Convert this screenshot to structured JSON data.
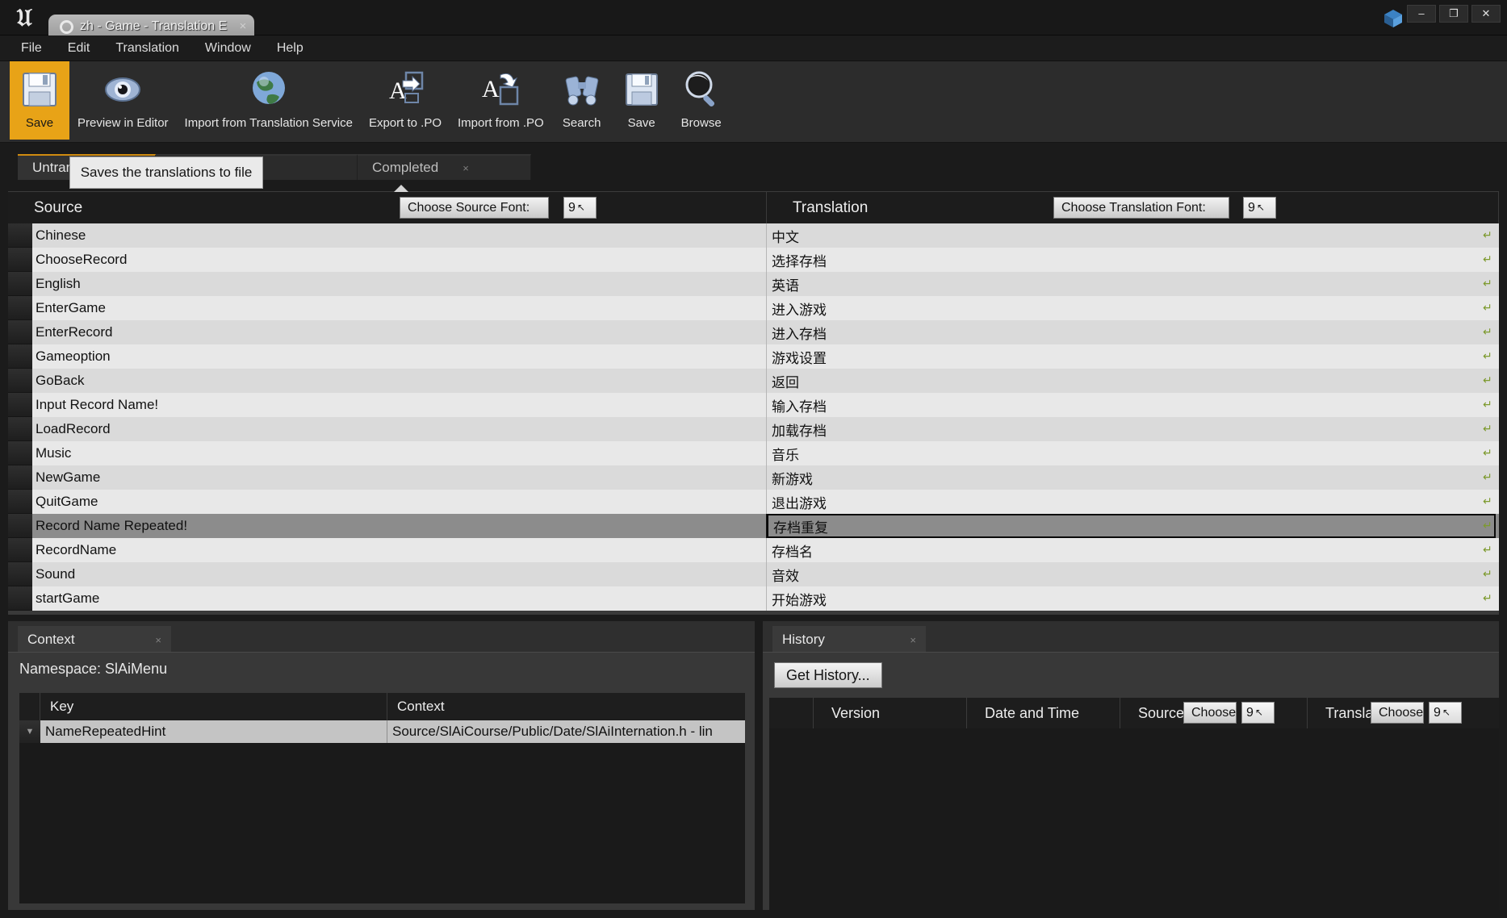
{
  "window": {
    "tab_title": "zh - Game - Translation E",
    "tab_close": "×",
    "minimize": "–",
    "maximize": "❐",
    "close": "✕"
  },
  "menubar": {
    "items": [
      {
        "label": "File"
      },
      {
        "label": "Edit"
      },
      {
        "label": "Translation"
      },
      {
        "label": "Window"
      },
      {
        "label": "Help"
      }
    ]
  },
  "toolbar": {
    "items": [
      {
        "label": "Save",
        "icon": "floppy-disk-icon",
        "active": true
      },
      {
        "label": "Preview in Editor",
        "icon": "eye-icon",
        "active": false
      },
      {
        "label": "Import from Translation Service",
        "icon": "globe-icon",
        "active": false
      },
      {
        "label": "Export to .PO",
        "icon": "export-letter-icon",
        "active": false
      },
      {
        "label": "Import from .PO",
        "icon": "import-letter-icon",
        "active": false
      },
      {
        "label": "Search",
        "icon": "binoculars-icon",
        "active": false
      },
      {
        "label": "Save",
        "icon": "floppy-disk-icon",
        "active": false
      },
      {
        "label": "Browse",
        "icon": "magnifier-icon",
        "active": false
      }
    ]
  },
  "tooltip": {
    "text": "Saves the translations to file"
  },
  "panel_tabs": [
    {
      "label": "Untranslated",
      "active": true,
      "close": "×"
    },
    {
      "label": "Review",
      "active": false,
      "close": "×"
    },
    {
      "label": "Completed",
      "active": false,
      "close": "×"
    }
  ],
  "columns": {
    "source_header": "Source",
    "translation_header": "Translation",
    "choose_source_font": "Choose Source Font:",
    "choose_translation_font": "Choose Translation Font:",
    "source_font_size": "9",
    "translation_font_size": "9",
    "spinner_arrows": "↖"
  },
  "rows": [
    {
      "source": "Chinese",
      "translation": "中文",
      "selected": false
    },
    {
      "source": "ChooseRecord",
      "translation": "选择存档",
      "selected": false
    },
    {
      "source": "English",
      "translation": "英语",
      "selected": false
    },
    {
      "source": "EnterGame",
      "translation": "进入游戏",
      "selected": false
    },
    {
      "source": "EnterRecord",
      "translation": "进入存档",
      "selected": false
    },
    {
      "source": "Gameoption",
      "translation": "游戏设置",
      "selected": false
    },
    {
      "source": "GoBack",
      "translation": "返回",
      "selected": false
    },
    {
      "source": "Input Record Name!",
      "translation": "输入存档",
      "selected": false
    },
    {
      "source": "LoadRecord",
      "translation": "加载存档",
      "selected": false
    },
    {
      "source": "Music",
      "translation": "音乐",
      "selected": false
    },
    {
      "source": "NewGame",
      "translation": "新游戏",
      "selected": false
    },
    {
      "source": "QuitGame",
      "translation": "退出游戏",
      "selected": false
    },
    {
      "source": "Record Name Repeated!",
      "translation": "存档重复",
      "selected": true
    },
    {
      "source": "RecordName",
      "translation": "存档名",
      "selected": false
    },
    {
      "source": "Sound",
      "translation": "音效",
      "selected": false
    },
    {
      "source": "startGame",
      "translation": "开始游戏",
      "selected": false
    }
  ],
  "context_panel": {
    "tab_label": "Context",
    "tab_close": "×",
    "namespace": "Namespace: SlAiMenu",
    "headers": {
      "key": "Key",
      "context": "Context"
    },
    "rows": [
      {
        "key": "NameRepeatedHint",
        "context": "Source/SlAiCourse/Public/Date/SlAiInternation.h - lin"
      }
    ]
  },
  "history_panel": {
    "tab_label": "History",
    "tab_close": "×",
    "get_history_button": "Get History...",
    "headers": {
      "version": "Version",
      "date_time": "Date and Time",
      "source": "Source",
      "translation": "Translation"
    },
    "source_font_button": "Choose Source Font:",
    "translation_font_button": "Choose Translation Font:",
    "source_font_size": "9",
    "translation_font_size": "9"
  },
  "colors": {
    "accent": "#e8a317",
    "row_odd": "#dadada",
    "row_even": "#e8e8e8",
    "row_selected": "#8c8c8c",
    "panel_bg": "#2f2f2f",
    "revert_icon": "#7d9a2e"
  }
}
